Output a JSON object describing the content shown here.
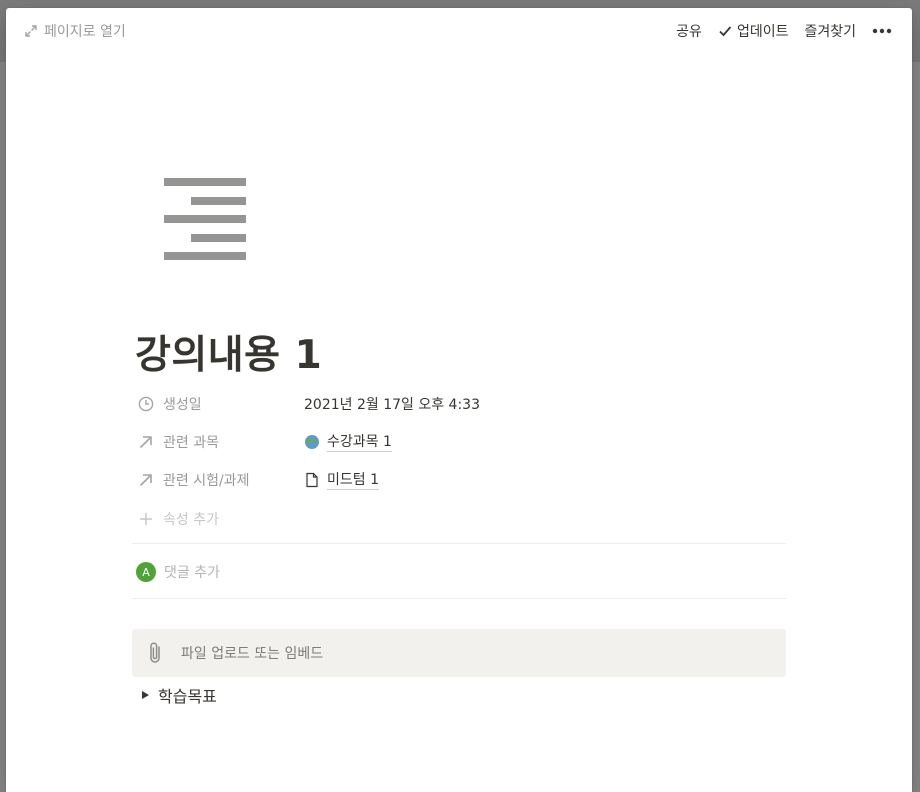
{
  "topbar": {
    "open_page_label": "페이지로 열기",
    "share_label": "공유",
    "updates_label": "업데이트",
    "favorite_label": "즐겨찾기",
    "more_label": "•••"
  },
  "page": {
    "title": "강의내용 1",
    "icon": "text-align-icon"
  },
  "properties": [
    {
      "name": "생성일",
      "icon": "clock-icon",
      "value": "2021년 2월 17일 오후 4:33"
    },
    {
      "name": "관련 과목",
      "icon": "arrow-up-right-icon",
      "value": "수강과목 1",
      "value_icon": "globe-icon"
    },
    {
      "name": "관련 시험/과제",
      "icon": "arrow-up-right-icon",
      "value": "미드텀 1",
      "value_icon": "document-icon"
    }
  ],
  "add_property_label": "속성 추가",
  "comment": {
    "avatar_letter": "A",
    "placeholder": "댓글 추가"
  },
  "embed_label": "파일 업로드 또는 임베드",
  "toggle_label": "학습목표",
  "colors": {
    "text": "#37352f",
    "muted": "#9b9a97",
    "embed_bg": "#f2f1ee",
    "avatar": "#4fa33a"
  }
}
